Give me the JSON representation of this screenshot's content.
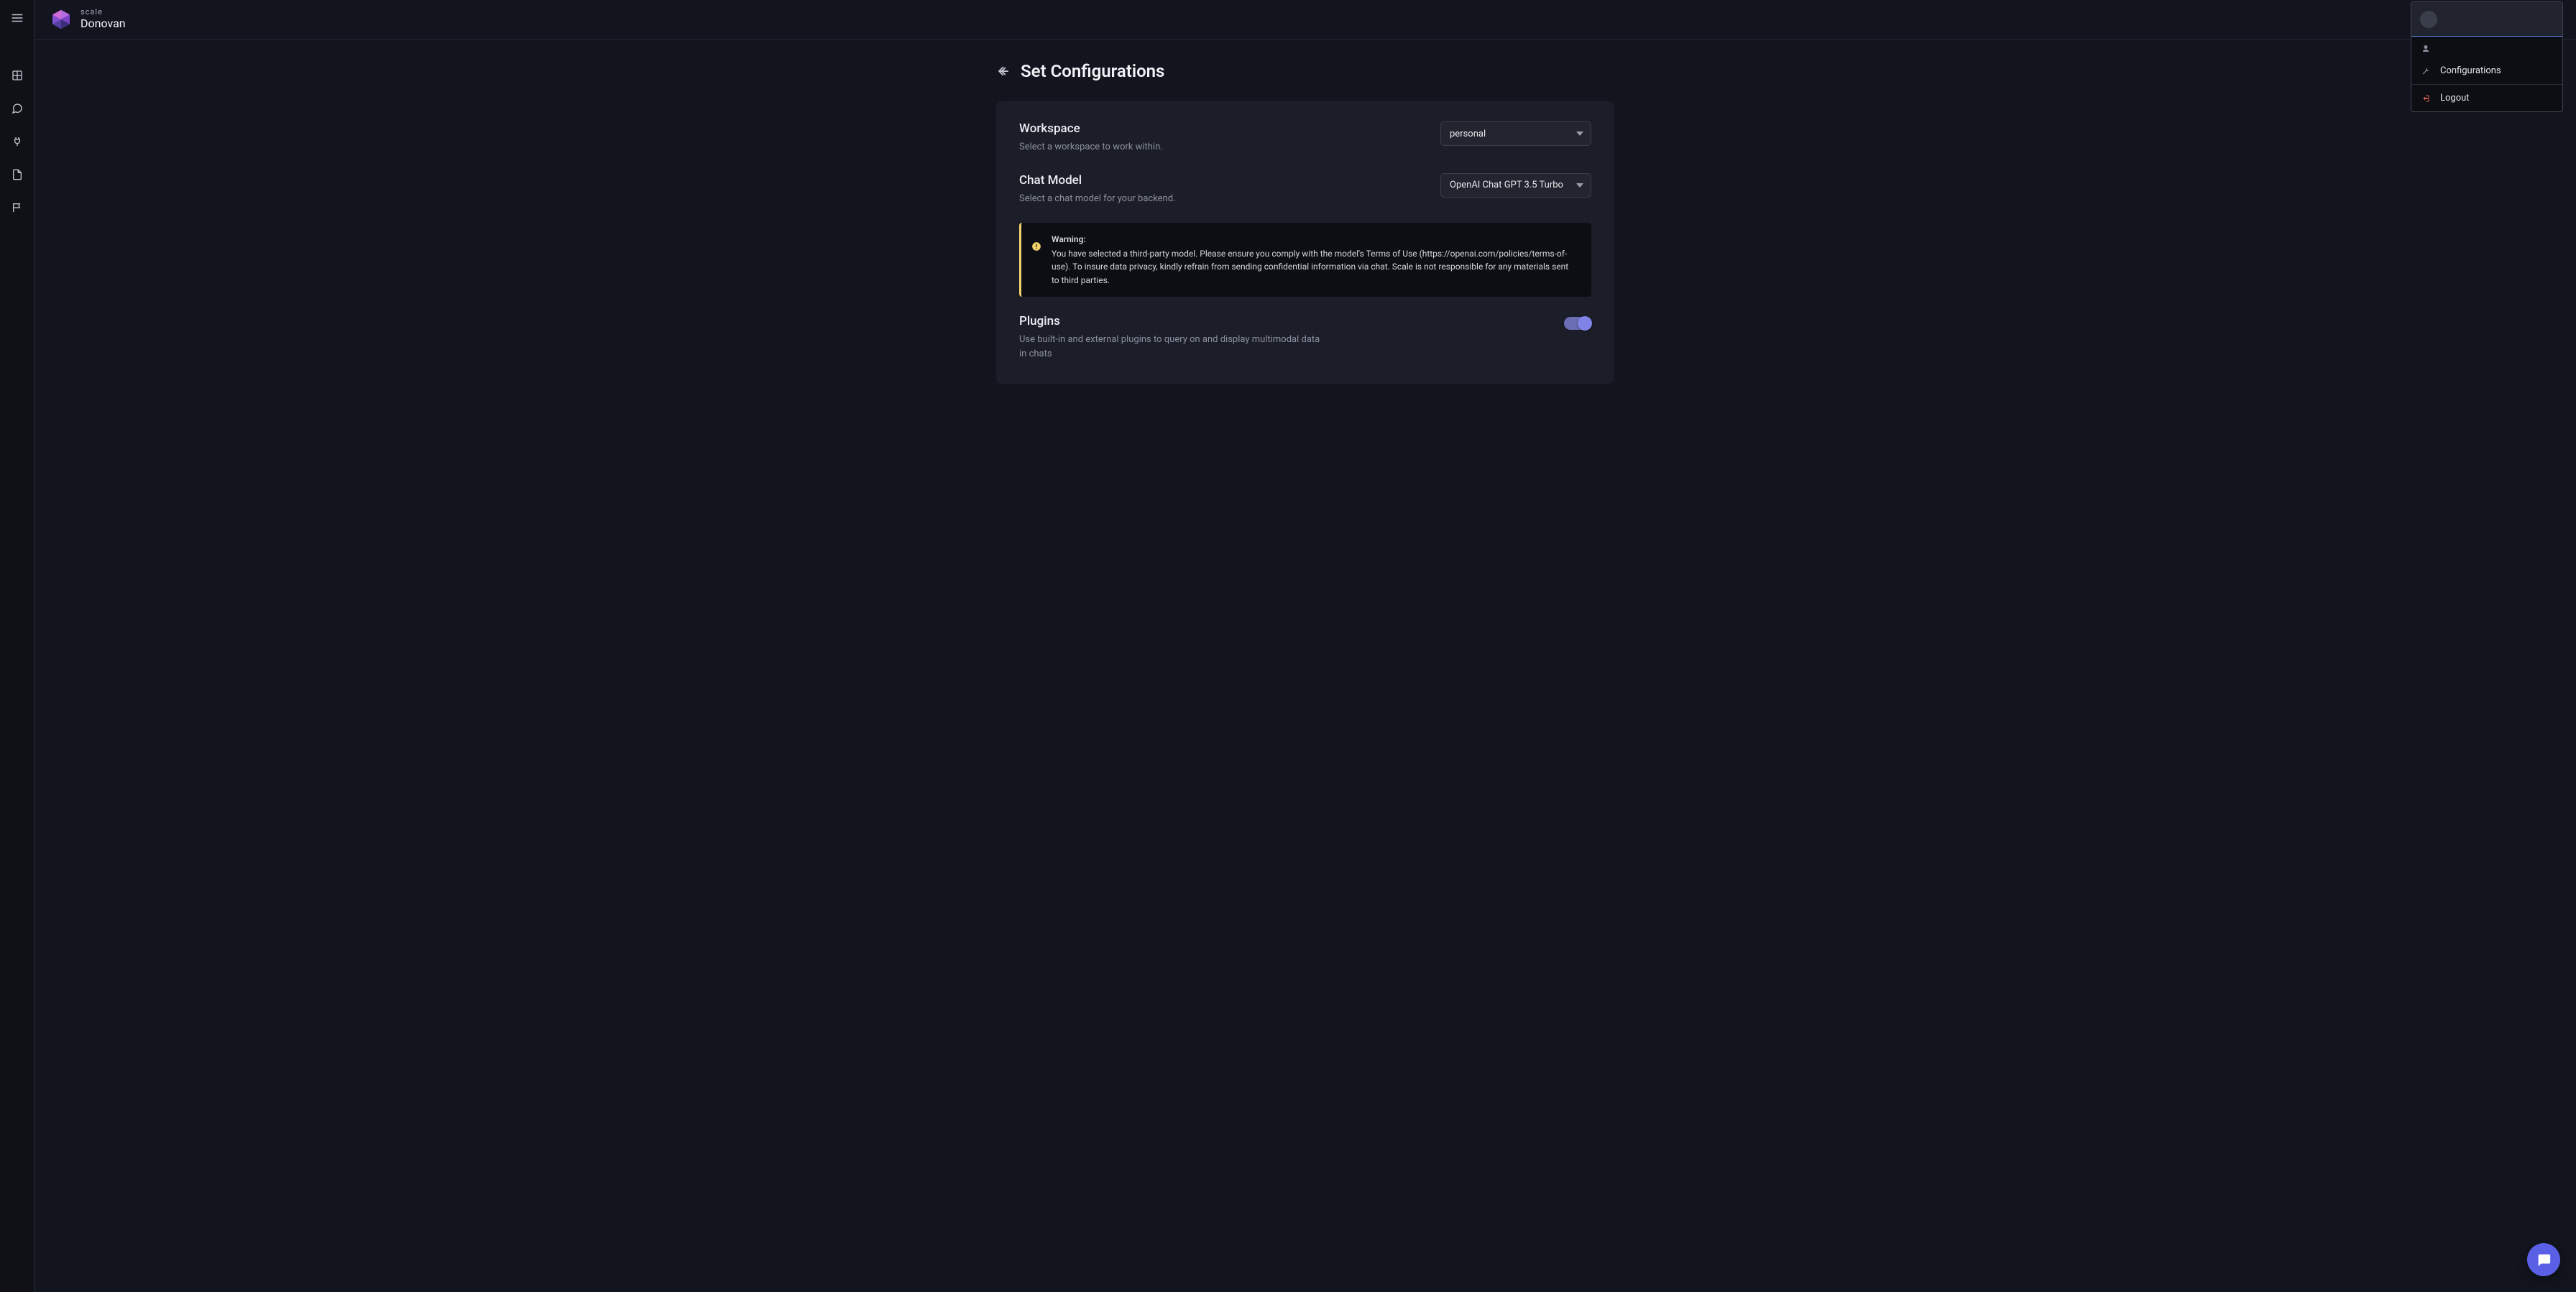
{
  "brand": {
    "small": "scale",
    "large": "Donovan"
  },
  "page": {
    "title": "Set Configurations"
  },
  "workspace": {
    "label": "Workspace",
    "desc": "Select a workspace to work within.",
    "selected": "personal"
  },
  "chatmodel": {
    "label": "Chat Model",
    "desc": "Select a chat model for your backend.",
    "selected": "OpenAI Chat GPT 3.5 Turbo"
  },
  "alert": {
    "title": "Warning:",
    "body": "You have selected a third-party model. Please ensure you comply with the model's Terms of Use (https://openai.com/policies/terms-of-use). To insure data privacy, kindly refrain from sending confidential information via chat. Scale is not responsible for any materials sent to third parties."
  },
  "plugins": {
    "label": "Plugins",
    "desc": "Use built-in and external plugins to query on and display multimodal data in chats",
    "enabled": true
  },
  "account_menu": {
    "configurations": "Configurations",
    "logout": "Logout"
  }
}
